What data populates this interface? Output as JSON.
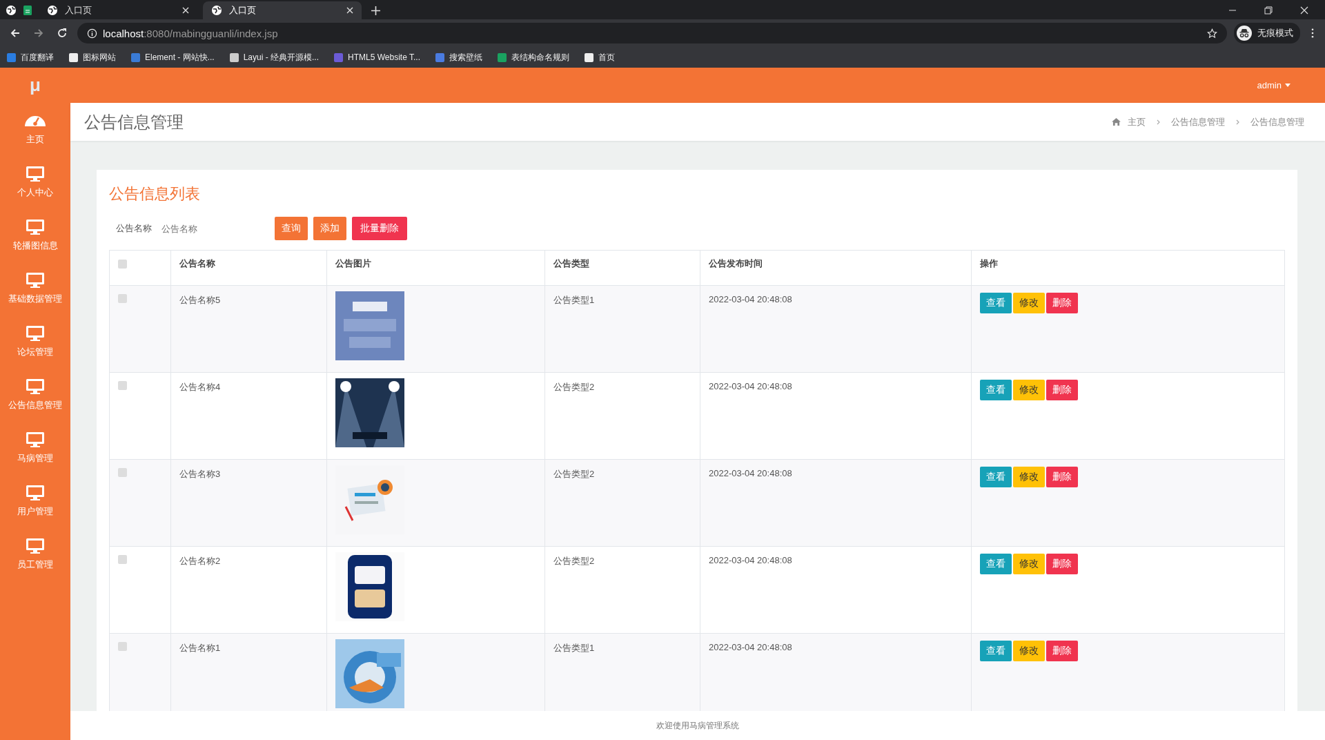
{
  "browser": {
    "tabs": [
      {
        "label": "入口页",
        "selected": false
      },
      {
        "label": "入口页",
        "selected": true
      }
    ],
    "url_host": "localhost",
    "url_rest": ":8080/mabingguanli/index.jsp",
    "profile": "无痕模式",
    "bookmarks": [
      "百度翻译",
      "图标网站",
      "Element - 网站快...",
      "Layui - 经典开源模...",
      "HTML5 Website T...",
      "搜索壁纸",
      "表结构命名规则",
      "首页"
    ]
  },
  "logo": "μ",
  "user": "admin",
  "sidebar": [
    {
      "label": "主页",
      "kind": "dashboard"
    },
    {
      "label": "个人中心",
      "kind": "monitor"
    },
    {
      "label": "轮播图信息",
      "kind": "monitor"
    },
    {
      "label": "基础数据管理",
      "kind": "monitor"
    },
    {
      "label": "论坛管理",
      "kind": "monitor"
    },
    {
      "label": "公告信息管理",
      "kind": "monitor"
    },
    {
      "label": "马病管理",
      "kind": "monitor"
    },
    {
      "label": "用户管理",
      "kind": "monitor"
    },
    {
      "label": "员工管理",
      "kind": "monitor"
    }
  ],
  "page_title": "公告信息管理",
  "breadcrumb": [
    "主页",
    "公告信息管理",
    "公告信息管理"
  ],
  "card_title": "公告信息列表",
  "search": {
    "label": "公告名称",
    "placeholder": "公告名称"
  },
  "toolbar": [
    {
      "label": "查询",
      "kind": "orange"
    },
    {
      "label": "添加",
      "kind": "orange"
    },
    {
      "label": "批量删除",
      "kind": "red"
    }
  ],
  "table": {
    "select_all": {
      "checked": false
    },
    "columns": [
      "公告名称",
      "公告图片",
      "公告类型",
      "公告发布时间",
      "操作"
    ],
    "rows": [
      {
        "checked": false,
        "name": "公告名称5",
        "type": "公告类型1",
        "time": "2022-03-04 20:48:08",
        "actions": [
          "查看",
          "修改",
          "删除"
        ]
      },
      {
        "checked": false,
        "name": "公告名称4",
        "type": "公告类型2",
        "time": "2022-03-04 20:48:08",
        "actions": [
          "查看",
          "修改",
          "删除"
        ]
      },
      {
        "checked": false,
        "name": "公告名称3",
        "type": "公告类型2",
        "time": "2022-03-04 20:48:08",
        "actions": [
          "查看",
          "修改",
          "删除"
        ]
      },
      {
        "checked": false,
        "name": "公告名称2",
        "type": "公告类型2",
        "time": "2022-03-04 20:48:08",
        "actions": [
          "查看",
          "修改",
          "删除"
        ]
      },
      {
        "checked": false,
        "name": "公告名称1",
        "type": "公告类型1",
        "time": "2022-03-04 20:48:08",
        "actions": [
          "查看",
          "修改",
          "删除"
        ]
      }
    ]
  },
  "footer": "欢迎使用马病管理系统"
}
